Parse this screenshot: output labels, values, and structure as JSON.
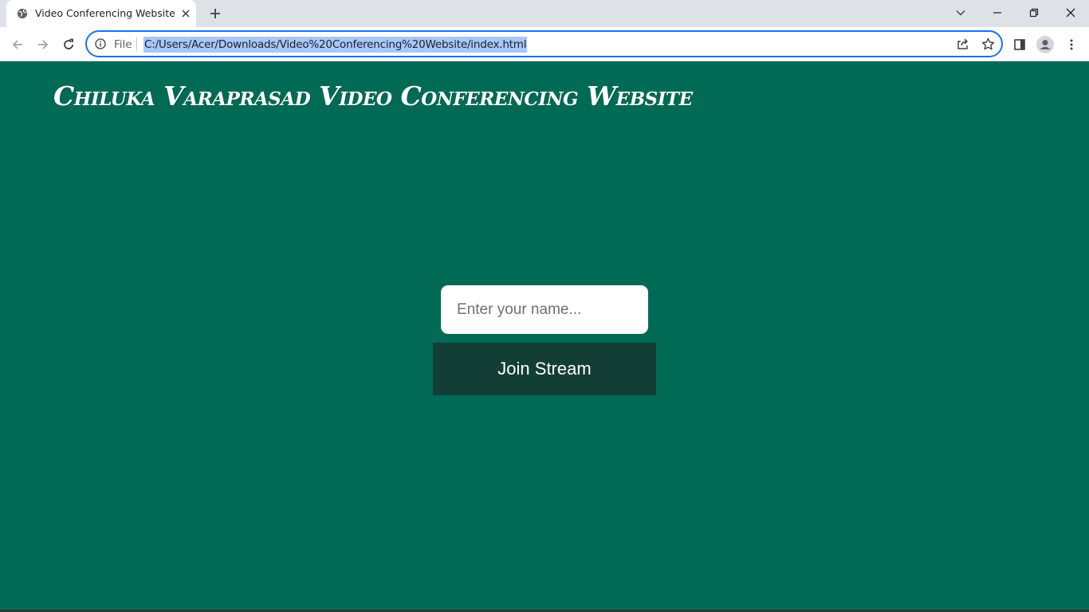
{
  "browser": {
    "tab_title": "Video Conferencing Website",
    "scheme_label": "File",
    "url": "C:/Users/Acer/Downloads/Video%20Conferencing%20Website/index.html",
    "accent_color": "#1a73e8",
    "url_highlight_color": "#a8c7fa"
  },
  "page": {
    "title": "Chiluka Varaprasad Video Conferencing Website",
    "background_color": "#006a55",
    "name_input": {
      "placeholder": "Enter your name...",
      "value": ""
    },
    "join_button_label": "Join Stream",
    "join_button_color": "#133e36"
  }
}
